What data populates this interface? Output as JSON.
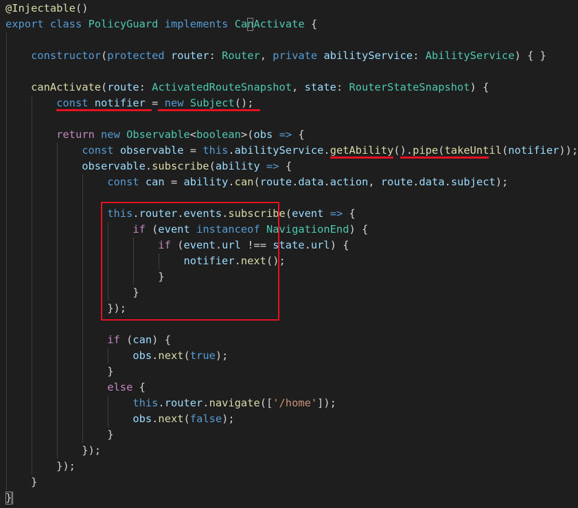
{
  "code_lines": [
    [
      {
        "c": "f",
        "t": "@Injectable"
      },
      {
        "c": "p",
        "t": "()"
      }
    ],
    [
      {
        "c": "k",
        "t": "export"
      },
      {
        "c": "p",
        "t": " "
      },
      {
        "c": "k",
        "t": "class"
      },
      {
        "c": "p",
        "t": " "
      },
      {
        "c": "t",
        "t": "PolicyGuard"
      },
      {
        "c": "p",
        "t": " "
      },
      {
        "c": "k",
        "t": "implements"
      },
      {
        "c": "p",
        "t": " "
      },
      {
        "c": "t",
        "t": "CanActivate"
      },
      {
        "c": "p",
        "t": " {"
      }
    ],
    [],
    [
      {
        "c": "p",
        "t": "    "
      },
      {
        "c": "k",
        "t": "constructor"
      },
      {
        "c": "p",
        "t": "("
      },
      {
        "c": "k",
        "t": "protected"
      },
      {
        "c": "p",
        "t": " "
      },
      {
        "c": "v",
        "t": "router"
      },
      {
        "c": "p",
        "t": ": "
      },
      {
        "c": "t",
        "t": "Router"
      },
      {
        "c": "p",
        "t": ", "
      },
      {
        "c": "k",
        "t": "private"
      },
      {
        "c": "p",
        "t": " "
      },
      {
        "c": "v",
        "t": "abilityService"
      },
      {
        "c": "p",
        "t": ": "
      },
      {
        "c": "t",
        "t": "AbilityService"
      },
      {
        "c": "p",
        "t": ") { }"
      }
    ],
    [],
    [
      {
        "c": "p",
        "t": "    "
      },
      {
        "c": "f",
        "t": "canActivate"
      },
      {
        "c": "p",
        "t": "("
      },
      {
        "c": "v",
        "t": "route"
      },
      {
        "c": "p",
        "t": ": "
      },
      {
        "c": "t",
        "t": "ActivatedRouteSnapshot"
      },
      {
        "c": "p",
        "t": ", "
      },
      {
        "c": "v",
        "t": "state"
      },
      {
        "c": "p",
        "t": ": "
      },
      {
        "c": "t",
        "t": "RouterStateSnapshot"
      },
      {
        "c": "p",
        "t": ") {"
      }
    ],
    [
      {
        "c": "p",
        "t": "        "
      },
      {
        "c": "k",
        "t": "const"
      },
      {
        "c": "p",
        "t": " "
      },
      {
        "c": "v",
        "t": "notifier"
      },
      {
        "c": "p",
        "t": " = "
      },
      {
        "c": "k",
        "t": "new"
      },
      {
        "c": "p",
        "t": " "
      },
      {
        "c": "t",
        "t": "Subject"
      },
      {
        "c": "p",
        "t": "();"
      }
    ],
    [],
    [
      {
        "c": "p",
        "t": "        "
      },
      {
        "c": "kc",
        "t": "return"
      },
      {
        "c": "p",
        "t": " "
      },
      {
        "c": "k",
        "t": "new"
      },
      {
        "c": "p",
        "t": " "
      },
      {
        "c": "t",
        "t": "Observable"
      },
      {
        "c": "p",
        "t": "<"
      },
      {
        "c": "t",
        "t": "boolean"
      },
      {
        "c": "p",
        "t": ">("
      },
      {
        "c": "v",
        "t": "obs"
      },
      {
        "c": "p",
        "t": " "
      },
      {
        "c": "k",
        "t": "=>"
      },
      {
        "c": "p",
        "t": " {"
      }
    ],
    [
      {
        "c": "p",
        "t": "            "
      },
      {
        "c": "k",
        "t": "const"
      },
      {
        "c": "p",
        "t": " "
      },
      {
        "c": "v",
        "t": "observable"
      },
      {
        "c": "p",
        "t": " = "
      },
      {
        "c": "k",
        "t": "this"
      },
      {
        "c": "p",
        "t": "."
      },
      {
        "c": "v",
        "t": "abilityService"
      },
      {
        "c": "p",
        "t": "."
      },
      {
        "c": "f",
        "t": "getAbility"
      },
      {
        "c": "p",
        "t": "()."
      },
      {
        "c": "f",
        "t": "pipe"
      },
      {
        "c": "p",
        "t": "("
      },
      {
        "c": "f",
        "t": "takeUntil"
      },
      {
        "c": "p",
        "t": "("
      },
      {
        "c": "v",
        "t": "notifier"
      },
      {
        "c": "p",
        "t": "));"
      }
    ],
    [
      {
        "c": "p",
        "t": "            "
      },
      {
        "c": "v",
        "t": "observable"
      },
      {
        "c": "p",
        "t": "."
      },
      {
        "c": "f",
        "t": "subscribe"
      },
      {
        "c": "p",
        "t": "("
      },
      {
        "c": "v",
        "t": "ability"
      },
      {
        "c": "p",
        "t": " "
      },
      {
        "c": "k",
        "t": "=>"
      },
      {
        "c": "p",
        "t": " {"
      }
    ],
    [
      {
        "c": "p",
        "t": "                "
      },
      {
        "c": "k",
        "t": "const"
      },
      {
        "c": "p",
        "t": " "
      },
      {
        "c": "v",
        "t": "can"
      },
      {
        "c": "p",
        "t": " = "
      },
      {
        "c": "v",
        "t": "ability"
      },
      {
        "c": "p",
        "t": "."
      },
      {
        "c": "f",
        "t": "can"
      },
      {
        "c": "p",
        "t": "("
      },
      {
        "c": "v",
        "t": "route"
      },
      {
        "c": "p",
        "t": "."
      },
      {
        "c": "v",
        "t": "data"
      },
      {
        "c": "p",
        "t": "."
      },
      {
        "c": "v",
        "t": "action"
      },
      {
        "c": "p",
        "t": ", "
      },
      {
        "c": "v",
        "t": "route"
      },
      {
        "c": "p",
        "t": "."
      },
      {
        "c": "v",
        "t": "data"
      },
      {
        "c": "p",
        "t": "."
      },
      {
        "c": "v",
        "t": "subject"
      },
      {
        "c": "p",
        "t": ");"
      }
    ],
    [],
    [
      {
        "c": "p",
        "t": "                "
      },
      {
        "c": "k",
        "t": "this"
      },
      {
        "c": "p",
        "t": "."
      },
      {
        "c": "v",
        "t": "router"
      },
      {
        "c": "p",
        "t": "."
      },
      {
        "c": "v",
        "t": "events"
      },
      {
        "c": "p",
        "t": "."
      },
      {
        "c": "f",
        "t": "subscribe"
      },
      {
        "c": "p",
        "t": "("
      },
      {
        "c": "v",
        "t": "event"
      },
      {
        "c": "p",
        "t": " "
      },
      {
        "c": "k",
        "t": "=>"
      },
      {
        "c": "p",
        "t": " {"
      }
    ],
    [
      {
        "c": "p",
        "t": "                    "
      },
      {
        "c": "kc",
        "t": "if"
      },
      {
        "c": "p",
        "t": " ("
      },
      {
        "c": "v",
        "t": "event"
      },
      {
        "c": "p",
        "t": " "
      },
      {
        "c": "k",
        "t": "instanceof"
      },
      {
        "c": "p",
        "t": " "
      },
      {
        "c": "t",
        "t": "NavigationEnd"
      },
      {
        "c": "p",
        "t": ") {"
      }
    ],
    [
      {
        "c": "p",
        "t": "                        "
      },
      {
        "c": "kc",
        "t": "if"
      },
      {
        "c": "p",
        "t": " ("
      },
      {
        "c": "v",
        "t": "event"
      },
      {
        "c": "p",
        "t": "."
      },
      {
        "c": "v",
        "t": "url"
      },
      {
        "c": "p",
        "t": " !== "
      },
      {
        "c": "v",
        "t": "state"
      },
      {
        "c": "p",
        "t": "."
      },
      {
        "c": "v",
        "t": "url"
      },
      {
        "c": "p",
        "t": ") {"
      }
    ],
    [
      {
        "c": "p",
        "t": "                            "
      },
      {
        "c": "v",
        "t": "notifier"
      },
      {
        "c": "p",
        "t": "."
      },
      {
        "c": "f",
        "t": "next"
      },
      {
        "c": "p",
        "t": "();"
      }
    ],
    [
      {
        "c": "p",
        "t": "                        }"
      }
    ],
    [
      {
        "c": "p",
        "t": "                    }"
      }
    ],
    [
      {
        "c": "p",
        "t": "                });"
      }
    ],
    [],
    [
      {
        "c": "p",
        "t": "                "
      },
      {
        "c": "kc",
        "t": "if"
      },
      {
        "c": "p",
        "t": " ("
      },
      {
        "c": "v",
        "t": "can"
      },
      {
        "c": "p",
        "t": ") {"
      }
    ],
    [
      {
        "c": "p",
        "t": "                    "
      },
      {
        "c": "v",
        "t": "obs"
      },
      {
        "c": "p",
        "t": "."
      },
      {
        "c": "f",
        "t": "next"
      },
      {
        "c": "p",
        "t": "("
      },
      {
        "c": "k",
        "t": "true"
      },
      {
        "c": "p",
        "t": ");"
      }
    ],
    [
      {
        "c": "p",
        "t": "                }"
      }
    ],
    [
      {
        "c": "p",
        "t": "                "
      },
      {
        "c": "kc",
        "t": "else"
      },
      {
        "c": "p",
        "t": " {"
      }
    ],
    [
      {
        "c": "p",
        "t": "                    "
      },
      {
        "c": "k",
        "t": "this"
      },
      {
        "c": "p",
        "t": "."
      },
      {
        "c": "v",
        "t": "router"
      },
      {
        "c": "p",
        "t": "."
      },
      {
        "c": "f",
        "t": "navigate"
      },
      {
        "c": "p",
        "t": "(["
      },
      {
        "c": "s",
        "t": "'/home'"
      },
      {
        "c": "p",
        "t": "]);"
      }
    ],
    [
      {
        "c": "p",
        "t": "                    "
      },
      {
        "c": "v",
        "t": "obs"
      },
      {
        "c": "p",
        "t": "."
      },
      {
        "c": "f",
        "t": "next"
      },
      {
        "c": "p",
        "t": "("
      },
      {
        "c": "k",
        "t": "false"
      },
      {
        "c": "p",
        "t": ");"
      }
    ],
    [
      {
        "c": "p",
        "t": "                }"
      }
    ],
    [
      {
        "c": "p",
        "t": "            });"
      }
    ],
    [
      {
        "c": "p",
        "t": "        });"
      }
    ],
    [
      {
        "c": "p",
        "t": "    }"
      }
    ],
    [
      {
        "c": "p",
        "t": "}"
      }
    ]
  ],
  "colors": {
    "background": "#1e1e1e",
    "highlight": "#e81123",
    "keyword": "#569cd6",
    "control": "#c586c0",
    "type": "#4ec9b0",
    "function": "#dcdcaa",
    "variable": "#9cdcfe",
    "string": "#ce9178",
    "text": "#d4d4d4"
  }
}
